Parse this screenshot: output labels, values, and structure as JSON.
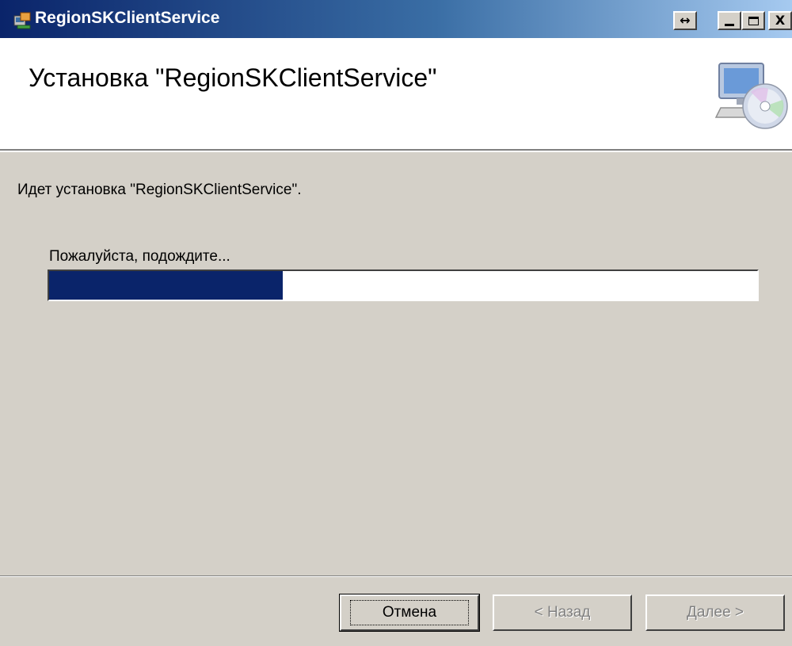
{
  "window": {
    "title": "RegionSKClientService",
    "resize_glyph": "↔",
    "close_glyph": "X",
    "icons": {
      "app": "installer-icon",
      "setup": "computer-cd-icon"
    }
  },
  "header": {
    "title": "Установка \"RegionSKClientService\""
  },
  "body": {
    "status": "Идет установка \"RegionSKClientService\".",
    "wait": "Пожалуйста, подождите...",
    "progress_fraction": 0.33
  },
  "buttons": {
    "cancel": "Отмена",
    "back": "< Назад",
    "next": "Далее >"
  },
  "colors": {
    "titlebar_start": "#0a246a",
    "progress_fill": "#0a246a",
    "dialog_bg": "#d4d0c8"
  }
}
